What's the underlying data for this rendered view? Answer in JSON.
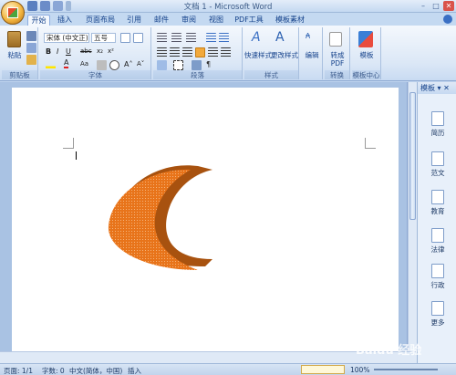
{
  "window": {
    "title": "文档 1 - Microsoft Word"
  },
  "tabs": [
    {
      "label": "开始",
      "active": true
    },
    {
      "label": "插入"
    },
    {
      "label": "页面布局"
    },
    {
      "label": "引用"
    },
    {
      "label": "邮件"
    },
    {
      "label": "审阅"
    },
    {
      "label": "视图"
    },
    {
      "label": "PDF工具"
    },
    {
      "label": "模板素材"
    }
  ],
  "ribbon": {
    "clipboard": {
      "paste_label": "粘贴",
      "group_label": "剪贴板"
    },
    "font": {
      "font_name": "宋体 (中文正)",
      "font_size": "五号",
      "group_label": "字体"
    },
    "paragraph": {
      "group_label": "段落"
    },
    "styles": {
      "quick_styles_label": "快速样式",
      "change_styles_label": "更改样式",
      "group_label": "样式"
    },
    "editing": {
      "label": "编辑"
    },
    "convert": {
      "label_line1": "转成",
      "label_line2": "PDF",
      "group_label": "转换"
    },
    "template": {
      "label": "模板",
      "group_label": "模板中心"
    }
  },
  "side_pane": {
    "title": "模板",
    "items": [
      "简历",
      "范文",
      "教育",
      "法律",
      "行政",
      "更多"
    ]
  },
  "status_bar": {
    "page": "页面: 1/1",
    "words": "字数: 0",
    "language": "中文(简体，中国)",
    "mode": "插入",
    "zoom": "100%"
  },
  "watermark": "Baidu 经验",
  "colors": {
    "shape_fill": "#e8741a",
    "shape_side": "#a8520f",
    "ribbon_bg": "#dbe7f6",
    "accent": "#15428b"
  }
}
